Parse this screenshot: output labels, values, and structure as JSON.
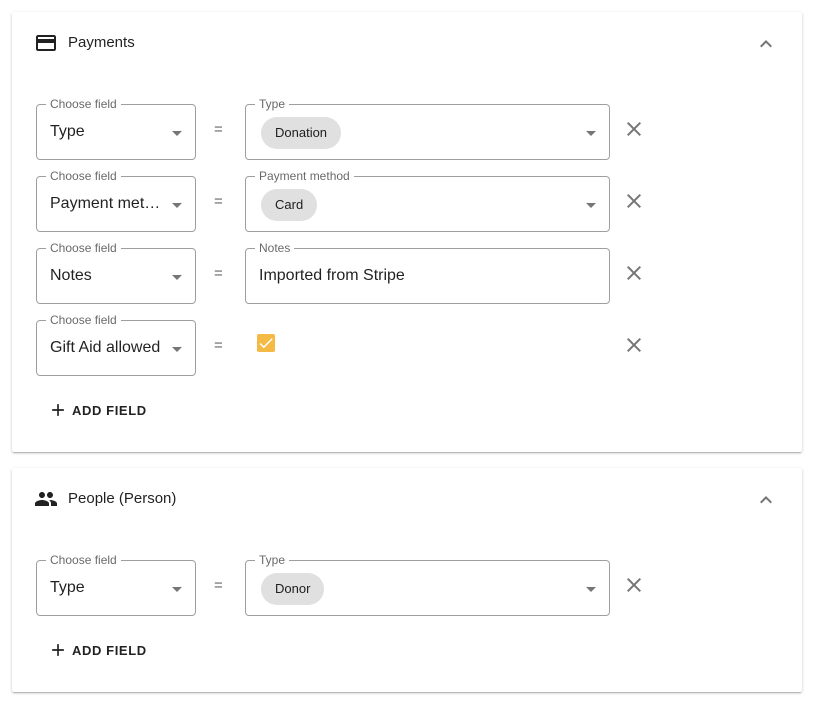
{
  "sections": [
    {
      "title": "Payments",
      "icon": "credit-card-icon",
      "rows": [
        {
          "choose_label": "Choose field",
          "choose_value": "Type",
          "value_label": "Type",
          "value_chip": "Donation"
        },
        {
          "choose_label": "Choose field",
          "choose_value": "Payment method",
          "value_label": "Payment method",
          "value_chip": "Card"
        },
        {
          "choose_label": "Choose field",
          "choose_value": "Notes",
          "value_label": "Notes",
          "value_text": "Imported from Stripe"
        },
        {
          "choose_label": "Choose field",
          "choose_value": "Gift Aid allowed",
          "value_checked": true
        }
      ],
      "add_label": "ADD FIELD"
    },
    {
      "title": "People (Person)",
      "icon": "people-icon",
      "rows": [
        {
          "choose_label": "Choose field",
          "choose_value": "Type",
          "value_label": "Type",
          "value_chip": "Donor"
        }
      ],
      "add_label": "ADD FIELD"
    }
  ],
  "operator": "=",
  "colors": {
    "checkbox": "#f5b945",
    "chip": "#e0e0e0"
  }
}
